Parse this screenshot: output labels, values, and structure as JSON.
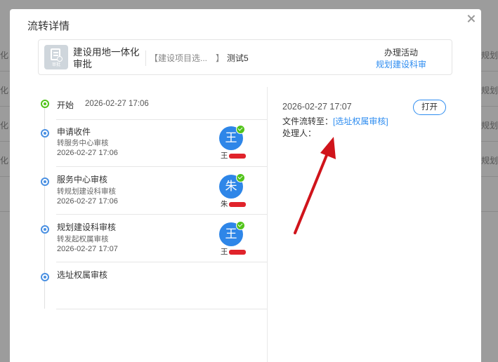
{
  "background": {
    "left_fragments": [
      "化",
      "化",
      "化",
      "化"
    ],
    "right_fragments": [
      "规划",
      "规划",
      "规划",
      "规划"
    ]
  },
  "modal": {
    "title": "流转详情",
    "close_icon": "close-icon"
  },
  "card": {
    "icon": "approval-doc-icon",
    "icon_label": "审批",
    "title": "建设用地一体化审批",
    "project": "【建设项目选...　】",
    "test": "测试5",
    "activity_label": "办理活动",
    "activity_value": "规划建设科审"
  },
  "timeline": [
    {
      "name": "开始",
      "time": "2026-02-27 17:06",
      "status": "done"
    },
    {
      "name": "申请收件",
      "sub": "转服务中心审核",
      "time": "2026-02-27 17:06",
      "avatar": "王",
      "handler": "王",
      "status": "pending"
    },
    {
      "name": "服务中心审核",
      "sub": "转规划建设科审核",
      "time": "2026-02-27 17:06",
      "avatar": "朱",
      "handler": "朱",
      "status": "pending"
    },
    {
      "name": "规划建设科审核",
      "sub": "转发起权属审核",
      "time": "2026-02-27 17:07",
      "avatar": "王",
      "handler": "王",
      "status": "pending"
    },
    {
      "name": "选址权属审核",
      "status": "pending"
    }
  ],
  "detail": {
    "time": "2026-02-27 17:07",
    "open_label": "打开",
    "flow_label": "文件流转至：",
    "flow_target": "[选址权属审核]",
    "handler_label": "处理人："
  },
  "colors": {
    "accent": "#2d8cf0",
    "done": "#52c41a",
    "avatar": "#2e86e8",
    "annotation": "#d0141b"
  }
}
